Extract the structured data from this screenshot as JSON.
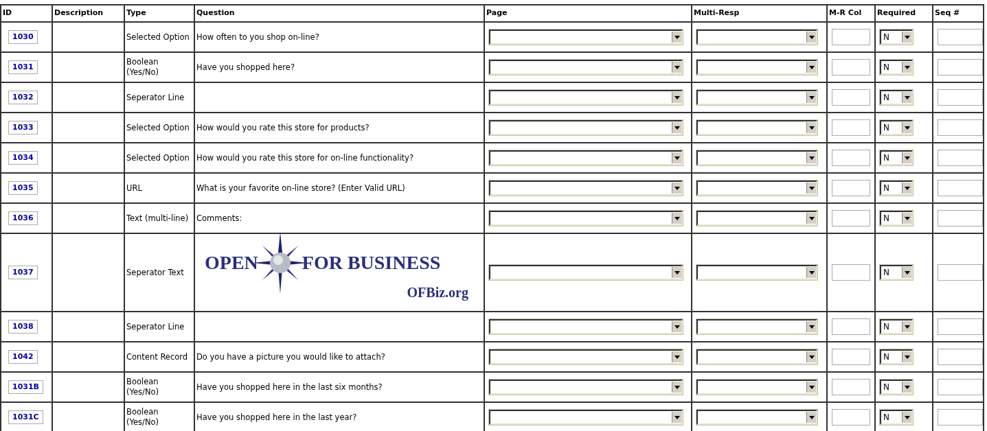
{
  "columns": [
    "ID",
    "Description",
    "Type",
    "Question",
    "Page",
    "Multi-Resp",
    "M-R Col",
    "Required",
    "Seq #"
  ],
  "rows": [
    {
      "id": "1030",
      "type": "Selected Option",
      "question": "How often to you shop on-line?",
      "required": "N"
    },
    {
      "id": "1031",
      "type": "Boolean (Yes/No)",
      "question": "Have you shopped here?",
      "required": "N"
    },
    {
      "id": "1032",
      "type": "Seperator Line",
      "required": "N"
    },
    {
      "id": "1033",
      "type": "Selected Option",
      "question": "How would you rate this store for products?",
      "required": "N"
    },
    {
      "id": "1034",
      "type": "Selected Option",
      "question": "How would you rate this store for on-line functionality?",
      "required": "N"
    },
    {
      "id": "1035",
      "type": "URL",
      "question": "What is your favorite on-line store? (Enter Valid URL)",
      "required": "N"
    },
    {
      "id": "1036",
      "type": "Text (multi-line)",
      "question": "Comments:",
      "required": "N"
    },
    {
      "id": "1037",
      "type": "Seperator Text",
      "logo": {
        "title_left": "OPEN",
        "title_right": "FOR BUSINESS",
        "subtitle": "OFBiz.org"
      },
      "required": "N"
    },
    {
      "id": "1038",
      "type": "Seperator Line",
      "required": "N"
    },
    {
      "id": "1042",
      "type": "Content Record",
      "question": "Do you have a picture you would like to attach?",
      "required": "N"
    },
    {
      "id": "1031B",
      "type": "Boolean (Yes/No)",
      "question": "Have you shopped here in the last six months?",
      "required": "N"
    },
    {
      "id": "1031C",
      "type": "Boolean (Yes/No)",
      "question": "Have you shopped here in the last year?",
      "required": "N"
    }
  ]
}
